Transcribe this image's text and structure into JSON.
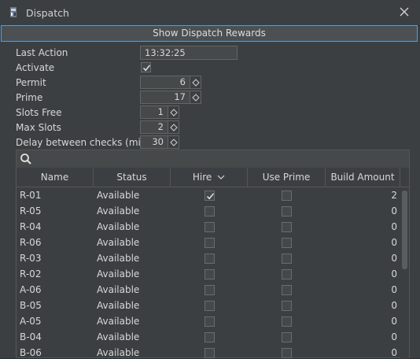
{
  "window": {
    "title": "Dispatch"
  },
  "rewards_button": "Show Dispatch Rewards",
  "form": {
    "last_action": {
      "label": "Last Action",
      "value": "13:32:25"
    },
    "activate": {
      "label": "Activate",
      "checked": true
    },
    "permit": {
      "label": "Permit",
      "value": "6"
    },
    "prime": {
      "label": "Prime",
      "value": "17"
    },
    "slots_free": {
      "label": "Slots Free",
      "value": "1"
    },
    "max_slots": {
      "label": "Max Slots",
      "value": "2"
    },
    "delay": {
      "label": "Delay between checks (min)",
      "value": "30"
    }
  },
  "table": {
    "search_placeholder": "",
    "columns": [
      "Name",
      "Status",
      "Hire",
      "Use Prime",
      "Build Amount"
    ],
    "hire_sort_indicator": "chevron-down",
    "rows": [
      {
        "name": "R-01",
        "status": "Available",
        "hire": true,
        "use_prime": false,
        "amount": "2"
      },
      {
        "name": "R-05",
        "status": "Available",
        "hire": false,
        "use_prime": false,
        "amount": "0"
      },
      {
        "name": "R-04",
        "status": "Available",
        "hire": false,
        "use_prime": false,
        "amount": "0"
      },
      {
        "name": "R-06",
        "status": "Available",
        "hire": false,
        "use_prime": false,
        "amount": "0"
      },
      {
        "name": "R-03",
        "status": "Available",
        "hire": false,
        "use_prime": false,
        "amount": "0"
      },
      {
        "name": "R-02",
        "status": "Available",
        "hire": false,
        "use_prime": false,
        "amount": "0"
      },
      {
        "name": "A-06",
        "status": "Available",
        "hire": false,
        "use_prime": false,
        "amount": "0"
      },
      {
        "name": "B-05",
        "status": "Available",
        "hire": false,
        "use_prime": false,
        "amount": "0"
      },
      {
        "name": "A-05",
        "status": "Available",
        "hire": false,
        "use_prime": false,
        "amount": "0"
      },
      {
        "name": "B-04",
        "status": "Available",
        "hire": false,
        "use_prime": false,
        "amount": "0"
      },
      {
        "name": "B-06",
        "status": "Available",
        "hire": false,
        "use_prime": false,
        "amount": "0"
      }
    ]
  },
  "colors": {
    "accent": "#5e9bcf",
    "background": "#3c3f41",
    "desktop": "#1c3446"
  }
}
